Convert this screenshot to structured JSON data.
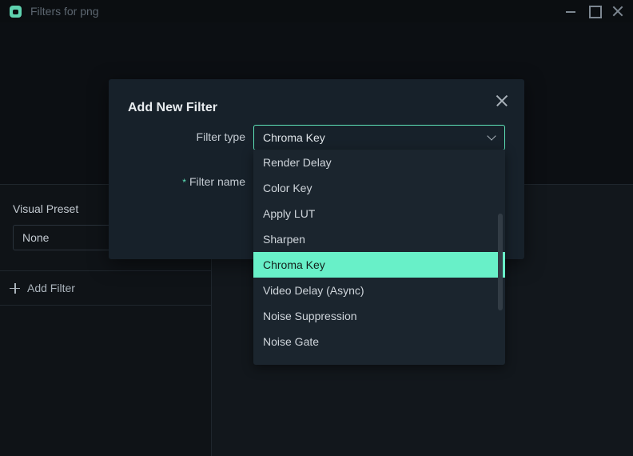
{
  "window": {
    "title": "Filters for png"
  },
  "left_panel": {
    "visual_preset_label": "Visual Preset",
    "visual_preset_value": "None",
    "add_filter_label": "Add Filter"
  },
  "modal": {
    "title": "Add New Filter",
    "filter_type_label": "Filter type",
    "filter_type_value": "Chroma Key",
    "filter_name_required_mark": "*",
    "filter_name_label": "Filter name"
  },
  "dropdown": {
    "items": [
      "Render Delay",
      "Color Key",
      "Apply LUT",
      "Sharpen",
      "Chroma Key",
      "Video Delay (Async)",
      "Noise Suppression",
      "Noise Gate"
    ],
    "selected": "Chroma Key"
  },
  "colors": {
    "accent": "#5ee3b8",
    "selected_item_bg": "#68f0c8",
    "modal_bg": "#17212a",
    "app_bg": "#0a0d10"
  },
  "icons": [
    "app-logo-icon",
    "minimize-icon",
    "maximize-icon",
    "close-icon",
    "plus-icon",
    "chevron-down-icon"
  ]
}
